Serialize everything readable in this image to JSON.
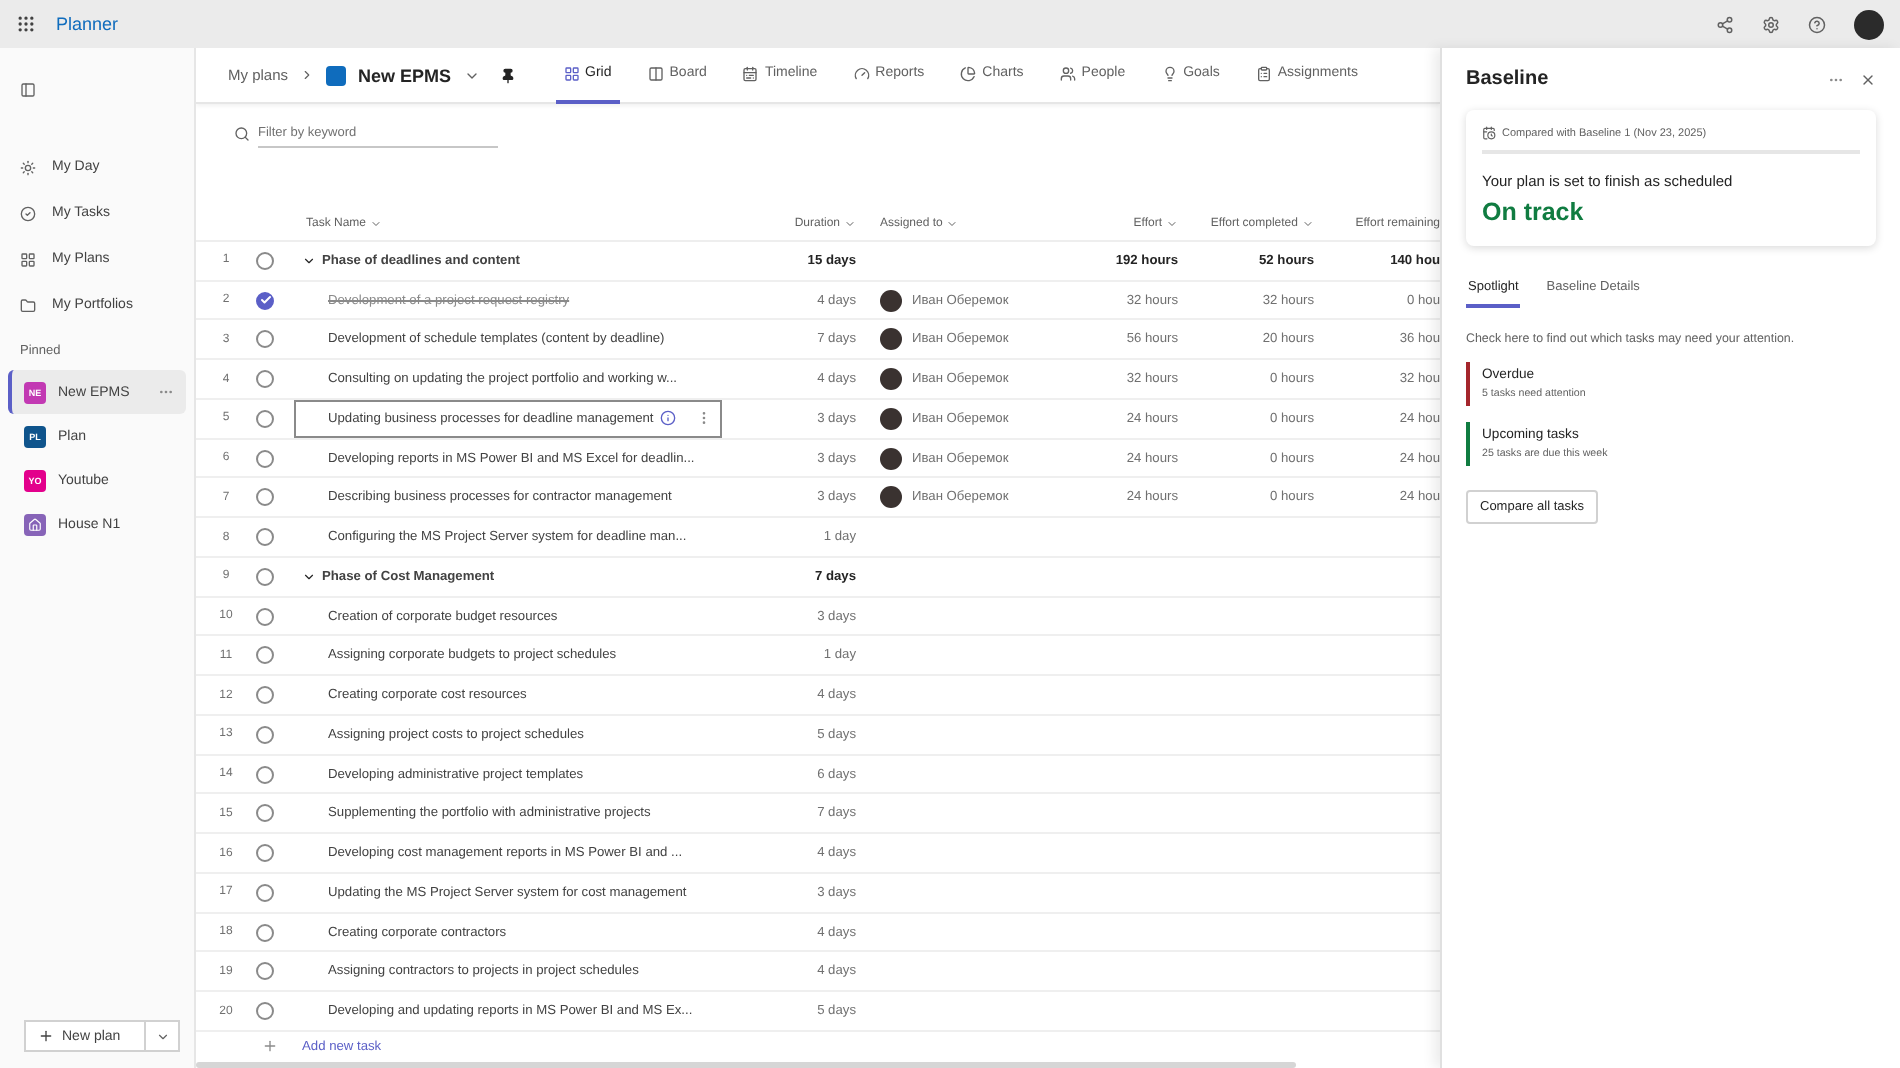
{
  "topbar": {
    "app_title": "Planner"
  },
  "sidebar": {
    "nav": [
      {
        "label": "My Day",
        "selected": false
      },
      {
        "label": "My Tasks",
        "selected": false
      },
      {
        "label": "My Plans",
        "selected": false
      },
      {
        "label": "My Portfolios",
        "selected": false
      }
    ],
    "pinned_label": "Pinned",
    "pinned": [
      {
        "label": "New EPMS",
        "initials": "NE",
        "color": "#c239b3",
        "selected": true
      },
      {
        "label": "Plan",
        "initials": "PL",
        "color": "#0f548c",
        "selected": false
      },
      {
        "label": "Youtube",
        "initials": "YO",
        "color": "#e3008c",
        "selected": false
      },
      {
        "label": "House N1",
        "color": "#8764b8",
        "selected": false
      }
    ],
    "new_plan_button": "New plan"
  },
  "header": {
    "breadcrumb": "My plans",
    "plan_name": "New EPMS",
    "tabs": [
      {
        "label": "Grid",
        "selected": true
      },
      {
        "label": "Board",
        "selected": false
      },
      {
        "label": "Timeline",
        "selected": false
      },
      {
        "label": "Reports",
        "selected": false
      },
      {
        "label": "Charts",
        "selected": false
      },
      {
        "label": "People",
        "selected": false
      },
      {
        "label": "Goals",
        "selected": false
      },
      {
        "label": "Assignments",
        "selected": false
      }
    ]
  },
  "filter": {
    "placeholder": "Filter by keyword"
  },
  "table": {
    "columns": [
      "Task Name",
      "Duration",
      "Assigned to",
      "Effort",
      "Effort completed",
      "Effort remaining"
    ],
    "rows": [
      {
        "number": "1",
        "kind": "group",
        "name": "Phase of deadlines and content",
        "completed": false,
        "focused": false,
        "duration": "15 days",
        "effort": "192 hours",
        "effort_completed": "52 hours",
        "effort_remaining": "140 hou"
      },
      {
        "number": "2",
        "kind": "task",
        "name": "Development of a project request registry",
        "completed": true,
        "focused": false,
        "duration": "4 days",
        "assignee": "Иван Оберемок",
        "effort": "32 hours",
        "effort_completed": "32 hours",
        "effort_remaining": "0 hou"
      },
      {
        "number": "3",
        "kind": "task",
        "name": "Development of schedule templates (content by deadline)",
        "completed": false,
        "focused": false,
        "duration": "7 days",
        "assignee": "Иван Оберемок",
        "effort": "56 hours",
        "effort_completed": "20 hours",
        "effort_remaining": "36 hou"
      },
      {
        "number": "4",
        "kind": "task",
        "name": "Consulting on updating the project portfolio and working w...",
        "completed": false,
        "focused": false,
        "duration": "4 days",
        "assignee": "Иван Оберемок",
        "effort": "32 hours",
        "effort_completed": "0 hours",
        "effort_remaining": "32 hou"
      },
      {
        "number": "5",
        "kind": "task",
        "name": "Updating business processes for deadline management",
        "completed": false,
        "focused": true,
        "duration": "3 days",
        "assignee": "Иван Оберемок",
        "effort": "24 hours",
        "effort_completed": "0 hours",
        "effort_remaining": "24 hou"
      },
      {
        "number": "6",
        "kind": "task",
        "name": "Developing reports in MS Power BI and MS Excel for deadlin...",
        "completed": false,
        "focused": false,
        "duration": "3 days",
        "assignee": "Иван Оберемок",
        "effort": "24 hours",
        "effort_completed": "0 hours",
        "effort_remaining": "24 hou"
      },
      {
        "number": "7",
        "kind": "task",
        "name": "Describing business processes for contractor management",
        "completed": false,
        "focused": false,
        "duration": "3 days",
        "assignee": "Иван Оберемок",
        "effort": "24 hours",
        "effort_completed": "0 hours",
        "effort_remaining": "24 hou"
      },
      {
        "number": "8",
        "kind": "task",
        "name": "Configuring the MS Project Server system for deadline man...",
        "completed": false,
        "focused": false,
        "duration": "1 day"
      },
      {
        "number": "9",
        "kind": "group",
        "name": "Phase of Cost Management",
        "completed": false,
        "focused": false,
        "duration": "7 days"
      },
      {
        "number": "10",
        "kind": "task",
        "name": "Creation of corporate budget resources",
        "completed": false,
        "focused": false,
        "duration": "3 days"
      },
      {
        "number": "11",
        "kind": "task",
        "name": "Assigning corporate budgets to project schedules",
        "completed": false,
        "focused": false,
        "duration": "1 day"
      },
      {
        "number": "12",
        "kind": "task",
        "name": "Creating corporate cost resources",
        "completed": false,
        "focused": false,
        "duration": "4 days"
      },
      {
        "number": "13",
        "kind": "task",
        "name": "Assigning project costs to project schedules",
        "completed": false,
        "focused": false,
        "duration": "5 days"
      },
      {
        "number": "14",
        "kind": "task",
        "name": "Developing administrative project templates",
        "completed": false,
        "focused": false,
        "duration": "6 days"
      },
      {
        "number": "15",
        "kind": "task",
        "name": "Supplementing the portfolio with administrative projects",
        "completed": false,
        "focused": false,
        "duration": "7 days"
      },
      {
        "number": "16",
        "kind": "task",
        "name": "Developing cost management reports in MS Power BI and ...",
        "completed": false,
        "focused": false,
        "duration": "4 days"
      },
      {
        "number": "17",
        "kind": "task",
        "name": "Updating the MS Project Server system for cost management",
        "completed": false,
        "focused": false,
        "duration": "3 days"
      },
      {
        "number": "18",
        "kind": "task",
        "name": "Creating corporate contractors",
        "completed": false,
        "focused": false,
        "duration": "4 days"
      },
      {
        "number": "19",
        "kind": "task",
        "name": "Assigning contractors to projects in project schedules",
        "completed": false,
        "focused": false,
        "duration": "4 days"
      },
      {
        "number": "20",
        "kind": "task",
        "name": "Developing and updating reports in MS Power BI and MS Ex...",
        "completed": false,
        "focused": false,
        "duration": "5 days"
      }
    ],
    "add_task": "Add new task"
  },
  "panel": {
    "title": "Baseline",
    "compared": "Compared with Baseline 1 (Nov 23, 2025)",
    "message": "Your plan is set to finish as scheduled",
    "status": "On track",
    "tabs": [
      {
        "label": "Spotlight",
        "selected": true
      },
      {
        "label": "Baseline Details",
        "selected": false
      }
    ],
    "hint": "Check here to find out which tasks may need your attention.",
    "cards": [
      {
        "title": "Overdue",
        "subtitle": "5 tasks need attention",
        "color": "#a4262c"
      },
      {
        "title": "Upcoming tasks",
        "subtitle": "25 tasks are due this week",
        "color": "#107c41"
      }
    ],
    "button": "Compare all tasks"
  }
}
